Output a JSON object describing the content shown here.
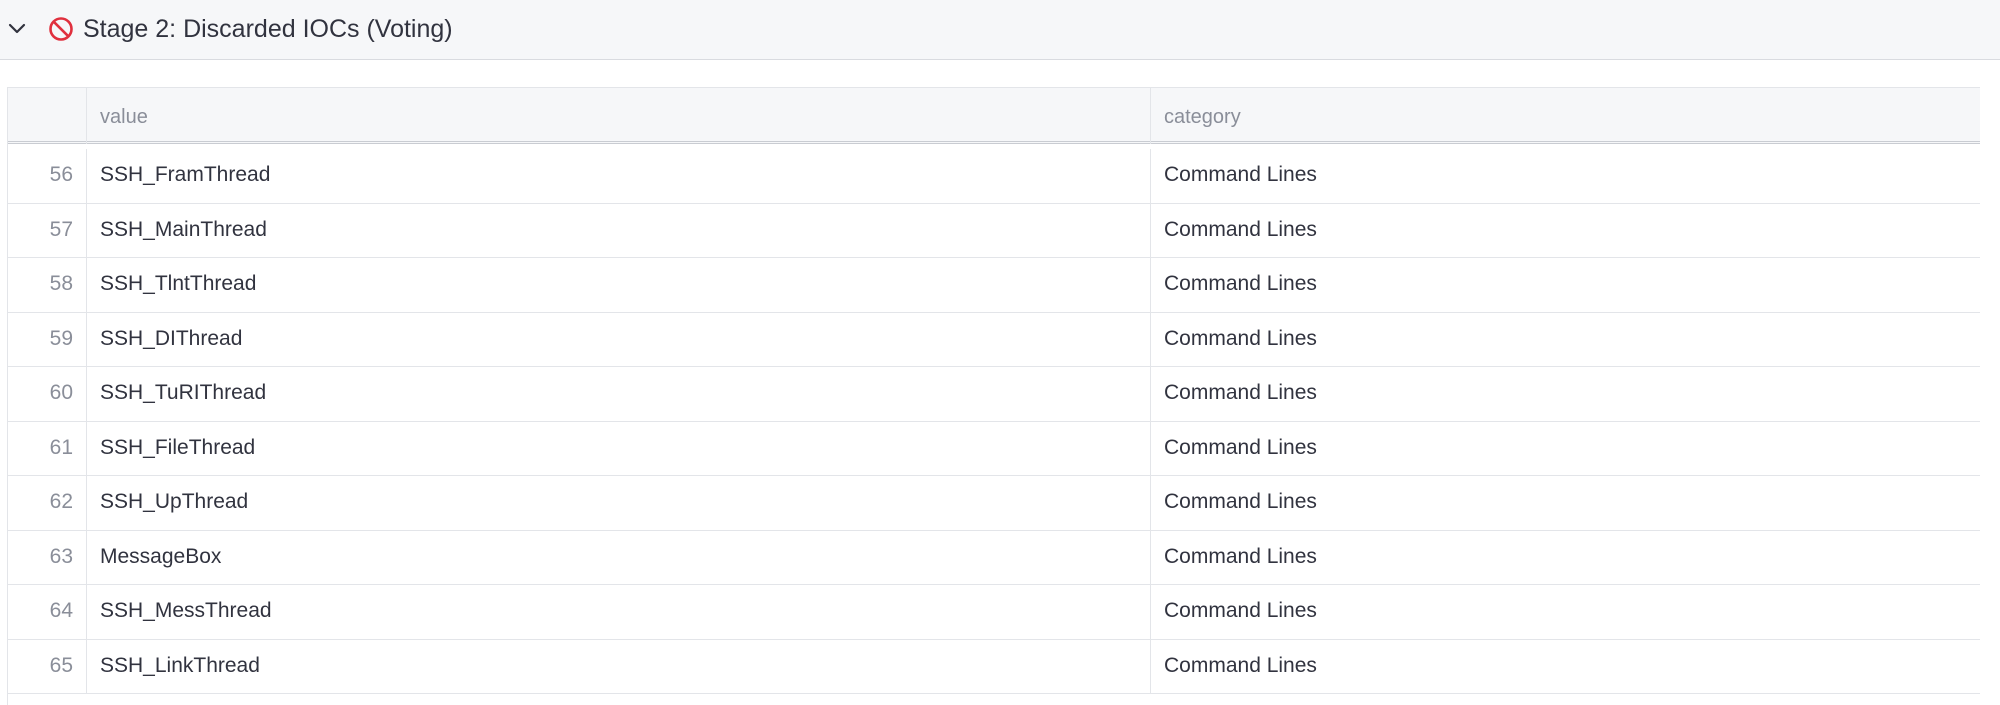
{
  "expander": {
    "title": "Stage 2: Discarded IOCs (Voting)",
    "chevron_icon": "chevron-down-icon",
    "status_icon": "ban-icon",
    "status_color": "#e0303e"
  },
  "table": {
    "columns": [
      "",
      "value",
      "category"
    ],
    "rows": [
      {
        "index": "56",
        "value": "SSH_FramThread",
        "category": "Command Lines"
      },
      {
        "index": "57",
        "value": "SSH_MainThread",
        "category": "Command Lines"
      },
      {
        "index": "58",
        "value": "SSH_TlntThread",
        "category": "Command Lines"
      },
      {
        "index": "59",
        "value": "SSH_DIThread",
        "category": "Command Lines"
      },
      {
        "index": "60",
        "value": "SSH_TuRIThread",
        "category": "Command Lines"
      },
      {
        "index": "61",
        "value": "SSH_FileThread",
        "category": "Command Lines"
      },
      {
        "index": "62",
        "value": "SSH_UpThread",
        "category": "Command Lines"
      },
      {
        "index": "63",
        "value": "MessageBox",
        "category": "Command Lines"
      },
      {
        "index": "64",
        "value": "SSH_MessThread",
        "category": "Command Lines"
      },
      {
        "index": "65",
        "value": "SSH_LinkThread",
        "category": "Command Lines"
      }
    ]
  }
}
